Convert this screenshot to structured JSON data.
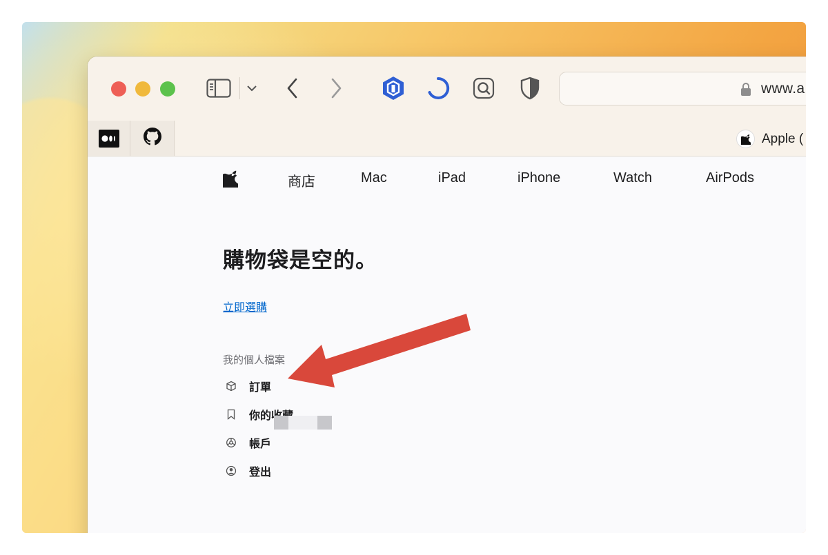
{
  "browser": {
    "url": "www.a",
    "bookmarks": [
      {
        "name": "medium",
        "icon": "medium-logo-icon"
      },
      {
        "name": "github",
        "icon": "github-icon"
      }
    ],
    "favorite_label": "Apple (",
    "icons": {
      "sidebar": "sidebar-icon",
      "back": "chevron-left-icon",
      "forward": "chevron-right-icon",
      "extension_1": "hexagon-extension-icon",
      "extension_2": "loading-ring-icon",
      "extension_3": "search-box-icon",
      "extension_4": "shield-icon"
    }
  },
  "nav": {
    "items": [
      "商店",
      "Mac",
      "iPad",
      "iPhone",
      "Watch",
      "AirPods"
    ]
  },
  "bag": {
    "title": "購物袋是空的。",
    "shop_link": "立即選購",
    "profile_label": "我的個人檔案",
    "profile_items": [
      {
        "label": "訂單",
        "icon": "box-icon"
      },
      {
        "label": "你的收藏",
        "icon": "bookmark-icon"
      },
      {
        "label": "帳戶",
        "icon": "gear-icon"
      },
      {
        "label": "登出",
        "icon": "person-circle-icon"
      }
    ]
  },
  "colors": {
    "link": "#0066cc",
    "arrow": "#d9483b",
    "traffic_red": "#ee5f56",
    "traffic_yellow": "#f0b93c",
    "traffic_green": "#5cc24c",
    "extension_blue": "#2f5fd4"
  }
}
